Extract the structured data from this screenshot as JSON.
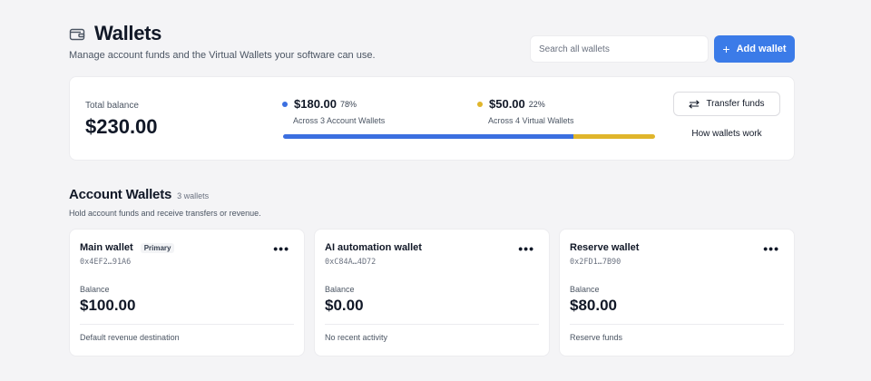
{
  "header": {
    "title": "Wallets",
    "icon": "wallet-icon",
    "subtitle": "Manage account funds and the Virtual Wallets your software can use.",
    "search_placeholder": "Search all wallets",
    "add_button_label": "Add wallet",
    "accent_color": "#3b7be8"
  },
  "summary": {
    "total_label": "Total balance",
    "total_value": "$230.00",
    "account": {
      "amount": "$180.00",
      "percent_label": "78%",
      "percent": 78,
      "caption": "Across 3 Account Wallets",
      "color": "#3b6fe0"
    },
    "virtual": {
      "amount": "$50.00",
      "percent_label": "22%",
      "percent": 22,
      "caption": "Across 4 Virtual Wallets",
      "color": "#e0b52b"
    },
    "transfer_button_label": "Transfer funds",
    "how_link_label": "How wallets work"
  },
  "account_section": {
    "title": "Account Wallets",
    "count_label": "3 wallets",
    "description": "Hold account funds and receive transfers or revenue.",
    "wallets": [
      {
        "name": "Main wallet",
        "badge": "Primary",
        "address": "0x4EF2…91A6",
        "balance_label": "Balance",
        "balance": "$100.00",
        "footnote": "Default revenue destination"
      },
      {
        "name": "AI automation wallet",
        "address": "0xC84A…4D72",
        "balance_label": "Balance",
        "balance": "$0.00",
        "footnote": "No recent activity"
      },
      {
        "name": "Reserve wallet",
        "address": "0x2FD1…7B90",
        "balance_label": "Balance",
        "balance": "$80.00",
        "footnote": "Reserve funds"
      }
    ]
  }
}
